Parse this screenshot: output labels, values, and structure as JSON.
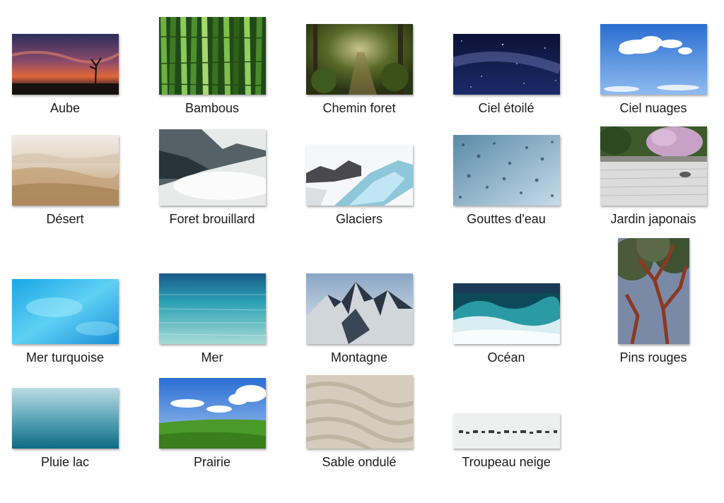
{
  "gallery": {
    "items": [
      {
        "name": "thumb-aube",
        "label": "Aube",
        "icon": "sunset-tree-image"
      },
      {
        "name": "thumb-bambous",
        "label": "Bambous",
        "icon": "bamboo-image"
      },
      {
        "name": "thumb-chemin-foret",
        "label": "Chemin foret",
        "icon": "forest-path-image"
      },
      {
        "name": "thumb-ciel-etoile",
        "label": "Ciel étoilé",
        "icon": "starry-sky-image"
      },
      {
        "name": "thumb-ciel-nuages",
        "label": "Ciel nuages",
        "icon": "cloudy-sky-image"
      },
      {
        "name": "thumb-desert",
        "label": "Désert",
        "icon": "desert-dunes-image"
      },
      {
        "name": "thumb-foret-brouillard",
        "label": "Foret brouillard",
        "icon": "misty-forest-image"
      },
      {
        "name": "thumb-glaciers",
        "label": "Glaciers",
        "icon": "glacier-image"
      },
      {
        "name": "thumb-gouttes-eau",
        "label": "Gouttes d'eau",
        "icon": "water-drops-image"
      },
      {
        "name": "thumb-jardin-japonais",
        "label": "Jardin japonais",
        "icon": "japanese-garden-image"
      },
      {
        "name": "thumb-mer-turquoise",
        "label": "Mer turquoise",
        "icon": "turquoise-sea-image"
      },
      {
        "name": "thumb-mer",
        "label": "Mer",
        "icon": "sea-image"
      },
      {
        "name": "thumb-montagne",
        "label": "Montagne",
        "icon": "mountain-image"
      },
      {
        "name": "thumb-ocean",
        "label": "Océan",
        "icon": "ocean-wave-image"
      },
      {
        "name": "thumb-pins-rouges",
        "label": "Pins rouges",
        "icon": "red-pines-image"
      },
      {
        "name": "thumb-pluie-lac",
        "label": "Pluie lac",
        "icon": "rain-lake-image"
      },
      {
        "name": "thumb-prairie",
        "label": "Prairie",
        "icon": "meadow-image"
      },
      {
        "name": "thumb-sable-ondule",
        "label": "Sable ondulé",
        "icon": "rippled-sand-image"
      },
      {
        "name": "thumb-troupeau-neige",
        "label": "Troupeau neige",
        "icon": "snow-herd-image"
      }
    ]
  }
}
